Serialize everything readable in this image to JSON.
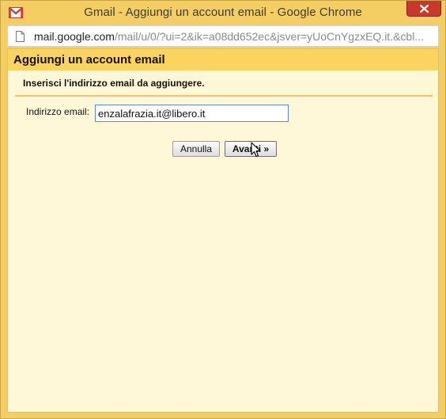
{
  "window": {
    "title": "Gmail - Aggiungi un account email - Google Chrome",
    "app_icon": "gmail-icon",
    "close_icon": "close-icon"
  },
  "address_bar": {
    "url_host": "mail.google.com",
    "url_path": "/mail/u/0/?ui=2&ik=a08dd652ec&jsver=yUoCnYgzxEQ.it.&cbl..."
  },
  "dialog": {
    "title": "Aggiungi un account email",
    "instruction": "Inserisci l'indirizzo email da aggiungere.",
    "email_label": "Indirizzo email:",
    "email_value": "enzalafrazia.it@libero.it",
    "cancel_label": "Annulla",
    "next_label": "Avanti »"
  },
  "colors": {
    "header": "#fbd35f",
    "page_background": "#fff8d8",
    "close_button": "#c7392b"
  }
}
